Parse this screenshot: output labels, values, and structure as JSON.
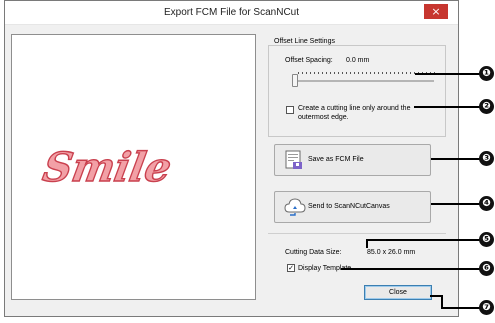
{
  "window": {
    "title": "Export FCM File for ScanNCut",
    "close_glyph": "×"
  },
  "preview": {
    "word": "Smile",
    "fill_color": "#f2a0a6",
    "stroke_color": "#c9404e"
  },
  "offset_group": {
    "title": "Offset Line Settings",
    "spacing_label": "Offset Spacing:",
    "spacing_value": "0.0 mm",
    "slider_value_fraction": 0.0
  },
  "outer_edge_checkbox": {
    "checked": false,
    "label_line1": "Create a cutting line only around the",
    "label_line2": "outermost edge."
  },
  "buttons": {
    "save_fcm": {
      "label": "Save as FCM File",
      "icon": "save-file-icon"
    },
    "send_canvas": {
      "label": "Send to ScanNCutCanvas",
      "icon": "cloud-upload-icon"
    },
    "close": {
      "label": "Close"
    }
  },
  "cutting_data": {
    "label": "Cutting Data Size:",
    "value": "85.0 x 26.0 mm"
  },
  "display_template": {
    "checked": true,
    "check_glyph": "✓",
    "label": "Display Template"
  },
  "callouts": [
    "❶",
    "❷",
    "❸",
    "❹",
    "❺",
    "❻",
    "❼"
  ],
  "colors": {
    "title_close_bg": "#c7362f",
    "default_button_border": "#3c7fb1"
  }
}
